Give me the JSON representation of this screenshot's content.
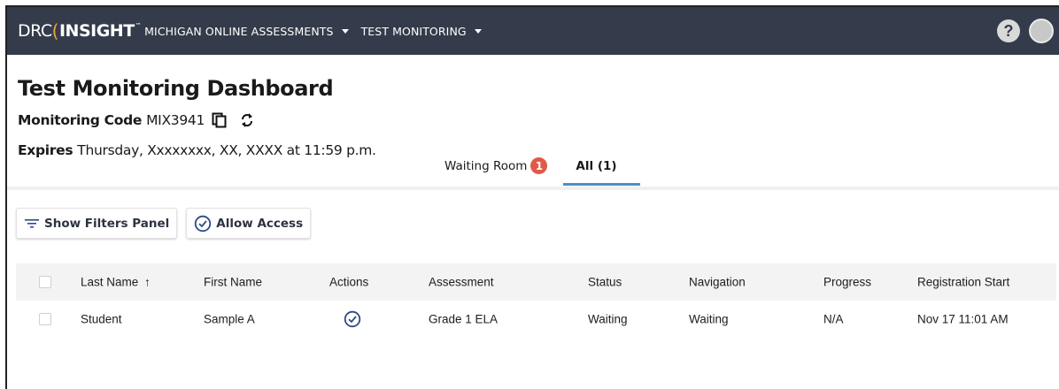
{
  "topbar": {
    "logo_drc": "DRC",
    "logo_insight": "INSIGHT",
    "logo_tm": "™",
    "menu": [
      {
        "label": "MICHIGAN ONLINE ASSESSMENTS"
      },
      {
        "label": "TEST MONITORING"
      }
    ],
    "help_label": "?"
  },
  "page": {
    "title": "Test Monitoring Dashboard",
    "monitoring_code_label": "Monitoring Code",
    "monitoring_code_value": "MIX3941",
    "expires_label": "Expires",
    "expires_value": "Thursday,  Xxxxxxxx, XX, XXXX at 11:59 p.m."
  },
  "tabs": [
    {
      "label": "Waiting Room",
      "badge": "1"
    },
    {
      "label": "All (1)",
      "active": true
    }
  ],
  "toolbar": {
    "filters_label": "Show Filters Panel",
    "allow_access_label": "Allow Access"
  },
  "table": {
    "columns": [
      "Last Name",
      "First Name",
      "Actions",
      "Assessment",
      "Status",
      "Navigation",
      "Progress",
      "Registration Start"
    ],
    "sort_indicator": "↑",
    "rows": [
      {
        "last_name": "Student",
        "first_name": "Sample A",
        "action_icon": "check-circle-icon",
        "assessment": "Grade 1 ELA",
        "status": "Waiting",
        "navigation": "Waiting",
        "progress": "N/A",
        "registration_start": "Nov 17 11:01 AM"
      }
    ]
  },
  "colors": {
    "topbar": "#343b4b",
    "accent_orange": "#f2a33a",
    "badge_red": "#e05a47",
    "tab_underline": "#4a8ec9"
  }
}
